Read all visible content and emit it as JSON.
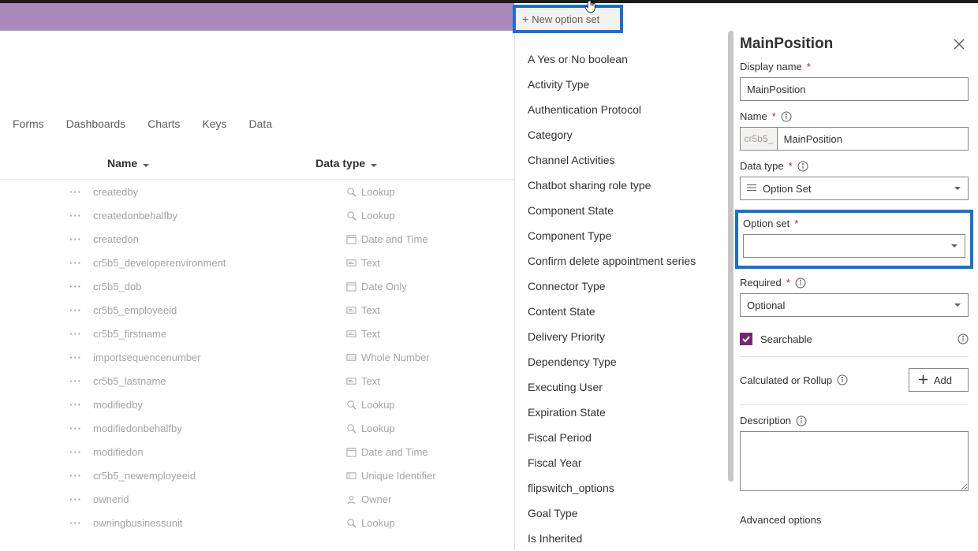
{
  "tabs": [
    "Forms",
    "Dashboards",
    "Charts",
    "Keys",
    "Data"
  ],
  "columns": {
    "name": "Name",
    "datatype": "Data type"
  },
  "rows": [
    {
      "name": "createdby",
      "dt": "Lookup",
      "icon": "lookup"
    },
    {
      "name": "createdonbehalfby",
      "dt": "Lookup",
      "icon": "lookup"
    },
    {
      "name": "createdon",
      "dt": "Date and Time",
      "icon": "datetime"
    },
    {
      "name": "cr5b5_developerenvironment",
      "dt": "Text",
      "icon": "text"
    },
    {
      "name": "cr5b5_dob",
      "dt": "Date Only",
      "icon": "dateonly"
    },
    {
      "name": "cr5b5_employeeid",
      "dt": "Text",
      "icon": "text"
    },
    {
      "name": "cr5b5_firstname",
      "dt": "Text",
      "icon": "text"
    },
    {
      "name": "importsequencenumber",
      "dt": "Whole Number",
      "icon": "number"
    },
    {
      "name": "cr5b5_lastname",
      "dt": "Text",
      "icon": "text"
    },
    {
      "name": "modifiedby",
      "dt": "Lookup",
      "icon": "lookup"
    },
    {
      "name": "modifiedonbehalfby",
      "dt": "Lookup",
      "icon": "lookup"
    },
    {
      "name": "modifiedon",
      "dt": "Date and Time",
      "icon": "datetime"
    },
    {
      "name": "cr5b5_newemployeeid",
      "dt": "Unique Identifier",
      "icon": "uid"
    },
    {
      "name": "ownerid",
      "dt": "Owner",
      "icon": "owner"
    },
    {
      "name": "owningbusinessunit",
      "dt": "Lookup",
      "icon": "lookup"
    }
  ],
  "flyout": {
    "new_label": "New option set",
    "items": [
      "A Yes or No boolean",
      "Activity Type",
      "Authentication Protocol",
      "Category",
      "Channel Activities",
      "Chatbot sharing role type",
      "Component State",
      "Component Type",
      "Confirm delete appointment series",
      "Connector Type",
      "Content State",
      "Delivery Priority",
      "Dependency Type",
      "Executing User",
      "Expiration State",
      "Fiscal Period",
      "Fiscal Year",
      "flipswitch_options",
      "Goal Type",
      "Is Inherited"
    ]
  },
  "panel": {
    "title": "MainPosition",
    "display_name_label": "Display name",
    "display_name_value": "MainPosition",
    "name_label": "Name",
    "name_prefix": "cr5b5_",
    "name_value": "MainPosition",
    "datatype_label": "Data type",
    "datatype_value": "Option Set",
    "optionset_label": "Option set",
    "optionset_value": "",
    "required_label": "Required",
    "required_value": "Optional",
    "searchable_label": "Searchable",
    "calc_label": "Calculated or Rollup",
    "add_label": "Add",
    "description_label": "Description",
    "advanced_label": "Advanced options"
  }
}
